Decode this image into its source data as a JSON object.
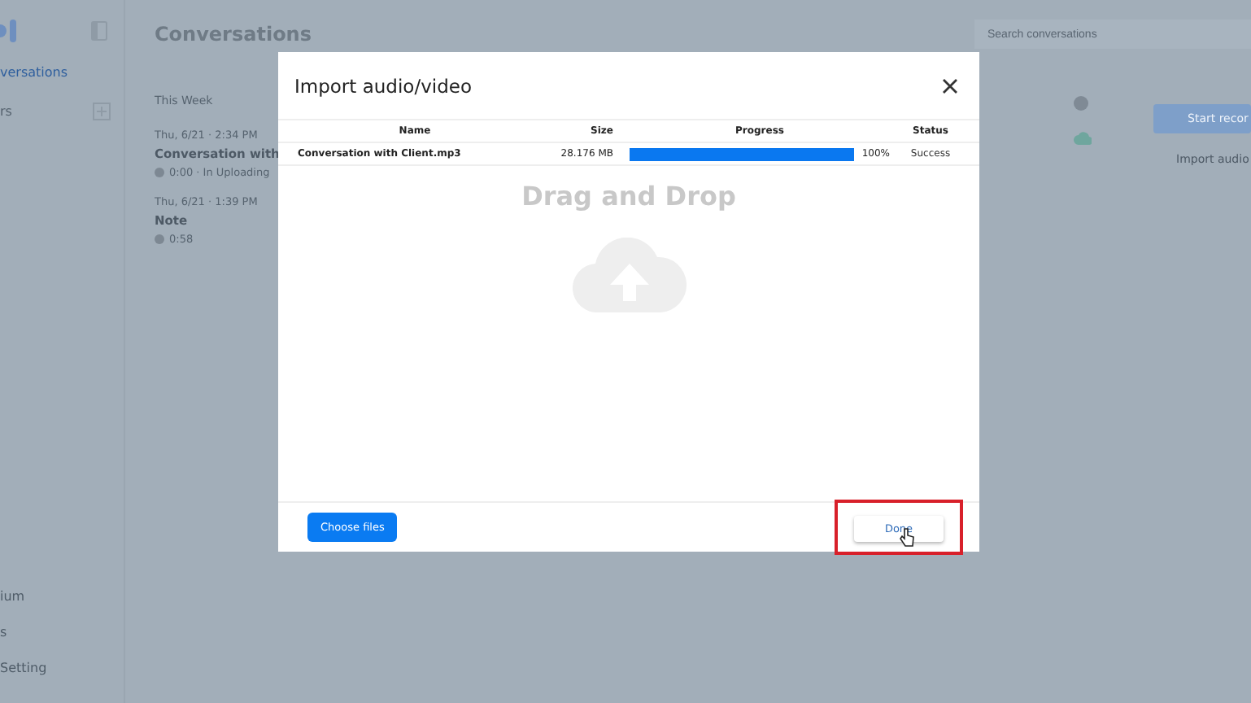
{
  "sidebar": {
    "items": [
      {
        "label": "versations",
        "selected": true
      },
      {
        "label": "rs",
        "selected": false
      }
    ],
    "bottom_items": [
      "ium",
      "s",
      "Setting"
    ]
  },
  "header": {
    "title": "Conversations",
    "search": {
      "placeholder": "Search conversations"
    }
  },
  "conversations": {
    "group": "This Week",
    "items": [
      {
        "time": "Thu, 6/21 · 2:34 PM",
        "title": "Conversation with",
        "meta": "0:00 · In Uploading"
      },
      {
        "time": "Thu, 6/21 · 1:39 PM",
        "title": "Note",
        "meta": "0:58"
      }
    ]
  },
  "actions": {
    "start": "Start recor",
    "import": "Import audio"
  },
  "dialog": {
    "title": "Import audio/video",
    "columns": [
      "Name",
      "Size",
      "Progress",
      "Status"
    ],
    "rows": [
      {
        "name": "Conversation with Client.mp3",
        "size": "28.176 MB",
        "level": 1.0,
        "percent": "100%",
        "status": "Success"
      }
    ],
    "drop_text": "Drag and Drop",
    "buttons": {
      "choose": "Choose files",
      "done": "Done"
    },
    "done_highlighted": true
  }
}
